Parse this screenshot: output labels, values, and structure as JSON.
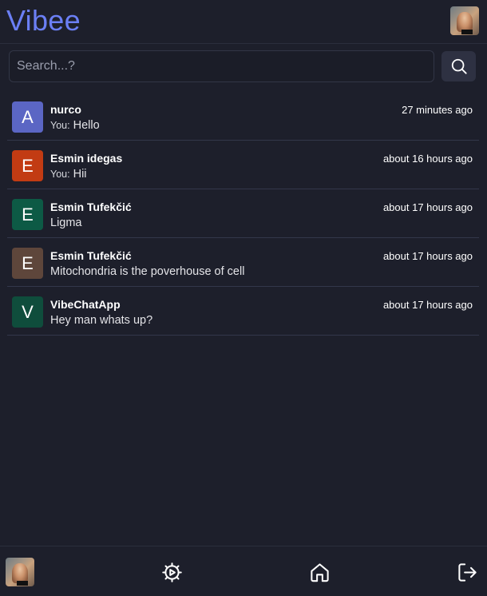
{
  "header": {
    "brand": "Vibee",
    "avatar_icon": "profile-photo"
  },
  "search": {
    "placeholder": "Search...?",
    "value": "",
    "button_icon": "search-icon"
  },
  "conversations": [
    {
      "initial": "A",
      "avatar_color": "#5b66c4",
      "name": "nurco",
      "time": "27 minutes ago",
      "prefix": "You:",
      "message": "Hello"
    },
    {
      "initial": "E",
      "avatar_color": "#c23b13",
      "name": "Esmin idegas",
      "time": "about 16 hours ago",
      "prefix": "You:",
      "message": "Hii"
    },
    {
      "initial": "E",
      "avatar_color": "#0d5a45",
      "name": "Esmin Tufekčić",
      "time": "about 17 hours ago",
      "prefix": "",
      "message": "Ligma"
    },
    {
      "initial": "E",
      "avatar_color": "#5e463b",
      "name": "Esmin Tufekčić",
      "time": "about 17 hours ago",
      "prefix": "",
      "message": "Mitochondria is the poverhouse of cell"
    },
    {
      "initial": "V",
      "avatar_color": "#0f4d3c",
      "name": "VibeChatApp",
      "time": "about 17 hours ago",
      "prefix": "",
      "message": "Hey man whats up?"
    }
  ],
  "bottom_nav": {
    "avatar_icon": "profile-photo",
    "items": [
      "settings-icon",
      "home-icon",
      "logout-icon"
    ]
  },
  "colors": {
    "background": "#1d1f2b",
    "brand": "#6b7ff5",
    "divider": "#33374a"
  }
}
